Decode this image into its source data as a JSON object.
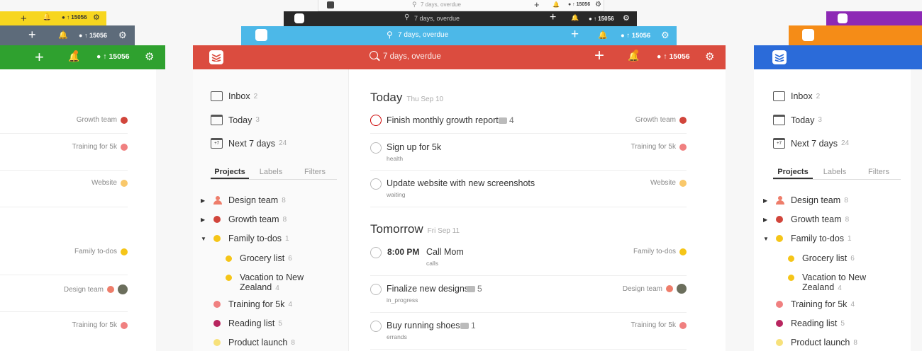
{
  "search": {
    "placeholder": "7 days, overdue"
  },
  "karma": {
    "score": "15056"
  },
  "nav": {
    "inbox": {
      "label": "Inbox",
      "count": "2"
    },
    "today": {
      "label": "Today",
      "count": "3"
    },
    "next7": {
      "label": "Next 7 days",
      "count": "24"
    }
  },
  "tabs": {
    "projects": "Projects",
    "labels": "Labels",
    "filters": "Filters"
  },
  "projects": [
    {
      "label": "Design team",
      "count": "8"
    },
    {
      "label": "Growth team",
      "count": "8"
    },
    {
      "label": "Family to-dos",
      "count": "1"
    },
    {
      "label": "Grocery list",
      "count": "6"
    },
    {
      "label": "Vacation to New",
      "label2": "Zealand",
      "count": "4"
    },
    {
      "label": "Training for 5k",
      "count": "4"
    },
    {
      "label": "Reading list",
      "count": "5"
    },
    {
      "label": "Product launch",
      "count": "8"
    }
  ],
  "sections": {
    "today": {
      "title": "Today",
      "date": "Thu Sep 10"
    },
    "tomorrow": {
      "title": "Tomorrow",
      "date": "Fri Sep 11"
    }
  },
  "tasks": [
    {
      "title": "Finish monthly growth report",
      "comments": "4",
      "project": "Growth team"
    },
    {
      "title": "Sign up for 5k",
      "label": "health",
      "project": "Training for 5k"
    },
    {
      "title": "Update website with new screenshots",
      "label": "waiting",
      "project": "Website"
    },
    {
      "time": "8:00 PM",
      "title": "Call Mom",
      "label": "calls",
      "project": "Family to-dos"
    },
    {
      "title": "Finalize new designs",
      "comments": "5",
      "label": "in_progress",
      "project": "Design team"
    },
    {
      "title": "Buy running shoes",
      "comments": "1",
      "label": "errands",
      "project": "Training for 5k"
    }
  ],
  "left_labels": [
    "Growth team",
    "Training for 5k",
    "Website",
    "Family to-dos",
    "Design team",
    "Training for 5k"
  ],
  "colors": {
    "red": "#db4c3f",
    "green": "#2fa12f",
    "yellow": "#f7d61f",
    "slate": "#5d6b7a",
    "dark": "#282828",
    "cyan": "#4cb8e8",
    "blue": "#2b6bd9",
    "orange": "#f58c17",
    "purple": "#8d29b5",
    "growth": "#d1453b",
    "training": "#f08080",
    "website": "#f9c86b",
    "family": "#f5c518",
    "design": "#ee7d6a",
    "reading": "#b8255f",
    "product": "#f7e17a"
  },
  "icons": [
    "plus-icon",
    "bell-icon",
    "karma-icon",
    "gear-icon",
    "search-icon",
    "todoist-logo-icon",
    "inbox-icon",
    "calendar-icon",
    "comment-icon",
    "chevron-right-icon",
    "chevron-down-icon",
    "person-icon",
    "avatar"
  ]
}
